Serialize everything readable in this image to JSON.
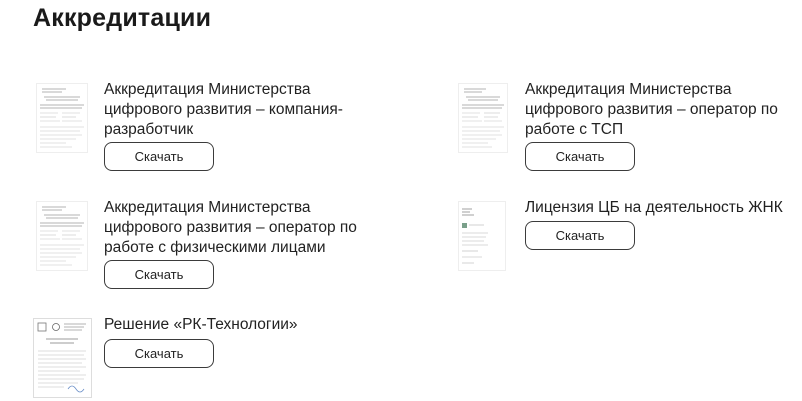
{
  "page": {
    "title": "Аккредитации"
  },
  "documents": [
    {
      "title": "Аккредитация Министерства цифрового развития – компания-разработчик",
      "button_label": "Скачать",
      "thumbnail_icon": "document-thumbnail-icon"
    },
    {
      "title": "Аккредитация Министерства цифрового развития – оператор по работе с ТСП",
      "button_label": "Скачать",
      "thumbnail_icon": "document-thumbnail-icon"
    },
    {
      "title": "Аккредитация Министерства цифрового развития – оператор по работе с физическими лицами",
      "button_label": "Скачать",
      "thumbnail_icon": "document-thumbnail-icon"
    },
    {
      "title": "Лицензия ЦБ на деятельность ЖНК",
      "button_label": "Скачать",
      "thumbnail_icon": "document-thumbnail-icon"
    },
    {
      "title": "Решение «РК-Технологии»",
      "button_label": "Скачать",
      "thumbnail_icon": "document-thumbnail-icon"
    }
  ],
  "colors": {
    "text": "#1e1e1e",
    "button_border": "#3b3b3b",
    "background": "#ffffff"
  }
}
